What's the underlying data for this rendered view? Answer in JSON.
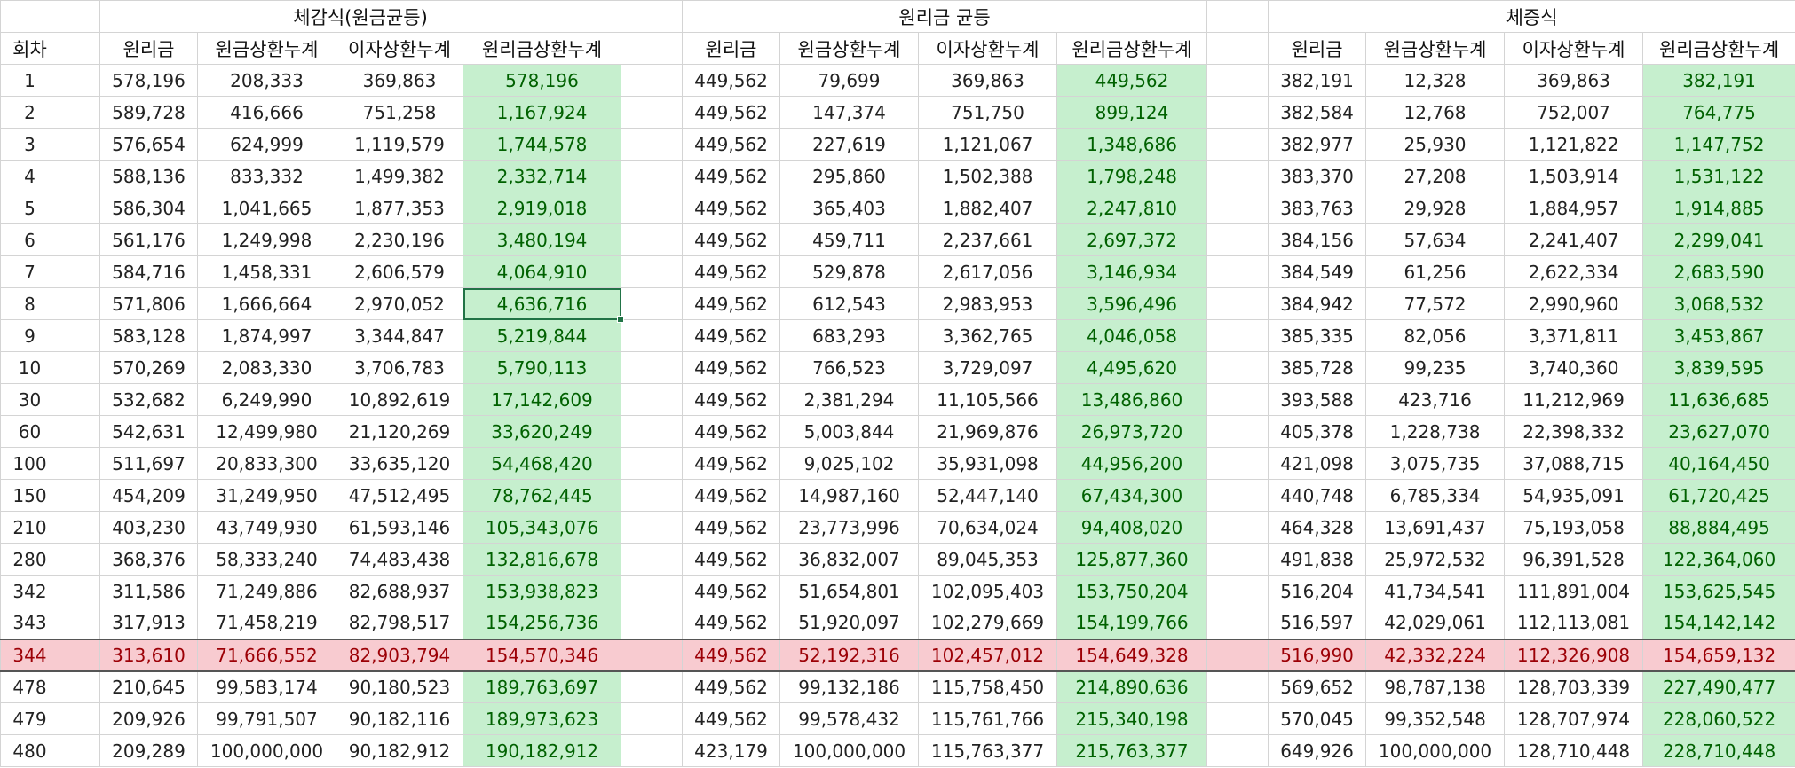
{
  "groups": {
    "a": "체감식(원금균등)",
    "b": "원리금 균등",
    "c": "체증식"
  },
  "columns": {
    "round": "회차",
    "principal_interest": "원리금",
    "principal_cum": "원금상환누계",
    "interest_cum": "이자상환누계",
    "total_cum": "원리금상환누계"
  },
  "rows": [
    {
      "n": "1",
      "a": [
        "578,196",
        "208,333",
        "369,863",
        "578,196"
      ],
      "b": [
        "449,562",
        "79,699",
        "369,863",
        "449,562"
      ],
      "c": [
        "382,191",
        "12,328",
        "369,863",
        "382,191"
      ]
    },
    {
      "n": "2",
      "a": [
        "589,728",
        "416,666",
        "751,258",
        "1,167,924"
      ],
      "b": [
        "449,562",
        "147,374",
        "751,750",
        "899,124"
      ],
      "c": [
        "382,584",
        "12,768",
        "752,007",
        "764,775"
      ]
    },
    {
      "n": "3",
      "a": [
        "576,654",
        "624,999",
        "1,119,579",
        "1,744,578"
      ],
      "b": [
        "449,562",
        "227,619",
        "1,121,067",
        "1,348,686"
      ],
      "c": [
        "382,977",
        "25,930",
        "1,121,822",
        "1,147,752"
      ]
    },
    {
      "n": "4",
      "a": [
        "588,136",
        "833,332",
        "1,499,382",
        "2,332,714"
      ],
      "b": [
        "449,562",
        "295,860",
        "1,502,388",
        "1,798,248"
      ],
      "c": [
        "383,370",
        "27,208",
        "1,503,914",
        "1,531,122"
      ]
    },
    {
      "n": "5",
      "a": [
        "586,304",
        "1,041,665",
        "1,877,353",
        "2,919,018"
      ],
      "b": [
        "449,562",
        "365,403",
        "1,882,407",
        "2,247,810"
      ],
      "c": [
        "383,763",
        "29,928",
        "1,884,957",
        "1,914,885"
      ]
    },
    {
      "n": "6",
      "a": [
        "561,176",
        "1,249,998",
        "2,230,196",
        "3,480,194"
      ],
      "b": [
        "449,562",
        "459,711",
        "2,237,661",
        "2,697,372"
      ],
      "c": [
        "384,156",
        "57,634",
        "2,241,407",
        "2,299,041"
      ]
    },
    {
      "n": "7",
      "a": [
        "584,716",
        "1,458,331",
        "2,606,579",
        "4,064,910"
      ],
      "b": [
        "449,562",
        "529,878",
        "2,617,056",
        "3,146,934"
      ],
      "c": [
        "384,549",
        "61,256",
        "2,622,334",
        "2,683,590"
      ]
    },
    {
      "n": "8",
      "a": [
        "571,806",
        "1,666,664",
        "2,970,052",
        "4,636,716"
      ],
      "b": [
        "449,562",
        "612,543",
        "2,983,953",
        "3,596,496"
      ],
      "c": [
        "384,942",
        "77,572",
        "2,990,960",
        "3,068,532"
      ]
    },
    {
      "n": "9",
      "a": [
        "583,128",
        "1,874,997",
        "3,344,847",
        "5,219,844"
      ],
      "b": [
        "449,562",
        "683,293",
        "3,362,765",
        "4,046,058"
      ],
      "c": [
        "385,335",
        "82,056",
        "3,371,811",
        "3,453,867"
      ]
    },
    {
      "n": "10",
      "a": [
        "570,269",
        "2,083,330",
        "3,706,783",
        "5,790,113"
      ],
      "b": [
        "449,562",
        "766,523",
        "3,729,097",
        "4,495,620"
      ],
      "c": [
        "385,728",
        "99,235",
        "3,740,360",
        "3,839,595"
      ]
    },
    {
      "n": "30",
      "a": [
        "532,682",
        "6,249,990",
        "10,892,619",
        "17,142,609"
      ],
      "b": [
        "449,562",
        "2,381,294",
        "11,105,566",
        "13,486,860"
      ],
      "c": [
        "393,588",
        "423,716",
        "11,212,969",
        "11,636,685"
      ]
    },
    {
      "n": "60",
      "a": [
        "542,631",
        "12,499,980",
        "21,120,269",
        "33,620,249"
      ],
      "b": [
        "449,562",
        "5,003,844",
        "21,969,876",
        "26,973,720"
      ],
      "c": [
        "405,378",
        "1,228,738",
        "22,398,332",
        "23,627,070"
      ]
    },
    {
      "n": "100",
      "a": [
        "511,697",
        "20,833,300",
        "33,635,120",
        "54,468,420"
      ],
      "b": [
        "449,562",
        "9,025,102",
        "35,931,098",
        "44,956,200"
      ],
      "c": [
        "421,098",
        "3,075,735",
        "37,088,715",
        "40,164,450"
      ]
    },
    {
      "n": "150",
      "a": [
        "454,209",
        "31,249,950",
        "47,512,495",
        "78,762,445"
      ],
      "b": [
        "449,562",
        "14,987,160",
        "52,447,140",
        "67,434,300"
      ],
      "c": [
        "440,748",
        "6,785,334",
        "54,935,091",
        "61,720,425"
      ]
    },
    {
      "n": "210",
      "a": [
        "403,230",
        "43,749,930",
        "61,593,146",
        "105,343,076"
      ],
      "b": [
        "449,562",
        "23,773,996",
        "70,634,024",
        "94,408,020"
      ],
      "c": [
        "464,328",
        "13,691,437",
        "75,193,058",
        "88,884,495"
      ]
    },
    {
      "n": "280",
      "a": [
        "368,376",
        "58,333,240",
        "74,483,438",
        "132,816,678"
      ],
      "b": [
        "449,562",
        "36,832,007",
        "89,045,353",
        "125,877,360"
      ],
      "c": [
        "491,838",
        "25,972,532",
        "96,391,528",
        "122,364,060"
      ]
    },
    {
      "n": "342",
      "a": [
        "311,586",
        "71,249,886",
        "82,688,937",
        "153,938,823"
      ],
      "b": [
        "449,562",
        "51,654,801",
        "102,095,403",
        "153,750,204"
      ],
      "c": [
        "516,204",
        "41,734,541",
        "111,891,004",
        "153,625,545"
      ]
    },
    {
      "n": "343",
      "a": [
        "317,913",
        "71,458,219",
        "82,798,517",
        "154,256,736"
      ],
      "b": [
        "449,562",
        "51,920,097",
        "102,279,669",
        "154,199,766"
      ],
      "c": [
        "516,597",
        "42,029,061",
        "112,113,081",
        "154,142,142"
      ]
    },
    {
      "n": "344",
      "a": [
        "313,610",
        "71,666,552",
        "82,903,794",
        "154,570,346"
      ],
      "b": [
        "449,562",
        "52,192,316",
        "102,457,012",
        "154,649,328"
      ],
      "c": [
        "516,990",
        "42,332,224",
        "112,326,908",
        "154,659,132"
      ]
    },
    {
      "n": "478",
      "a": [
        "210,645",
        "99,583,174",
        "90,180,523",
        "189,763,697"
      ],
      "b": [
        "449,562",
        "99,132,186",
        "115,758,450",
        "214,890,636"
      ],
      "c": [
        "569,652",
        "98,787,138",
        "128,703,339",
        "227,490,477"
      ]
    },
    {
      "n": "479",
      "a": [
        "209,926",
        "99,791,507",
        "90,182,116",
        "189,973,623"
      ],
      "b": [
        "449,562",
        "99,578,432",
        "115,761,766",
        "215,340,198"
      ],
      "c": [
        "570,045",
        "99,352,548",
        "128,707,974",
        "228,060,522"
      ]
    },
    {
      "n": "480",
      "a": [
        "209,289",
        "100,000,000",
        "90,182,912",
        "190,182,912"
      ],
      "b": [
        "423,179",
        "100,000,000",
        "115,763,377",
        "215,763,377"
      ],
      "c": [
        "649,926",
        "100,000,000",
        "128,710,448",
        "228,710,448"
      ]
    }
  ],
  "highlight_round": "344",
  "selected_cell": {
    "round": "8",
    "group": "a",
    "col": 3
  },
  "colors": {
    "green_fill": "#c6efce",
    "green_text": "#006100",
    "red_fill": "#f8cbd0",
    "red_text": "#9c0006",
    "selection": "#217346"
  }
}
